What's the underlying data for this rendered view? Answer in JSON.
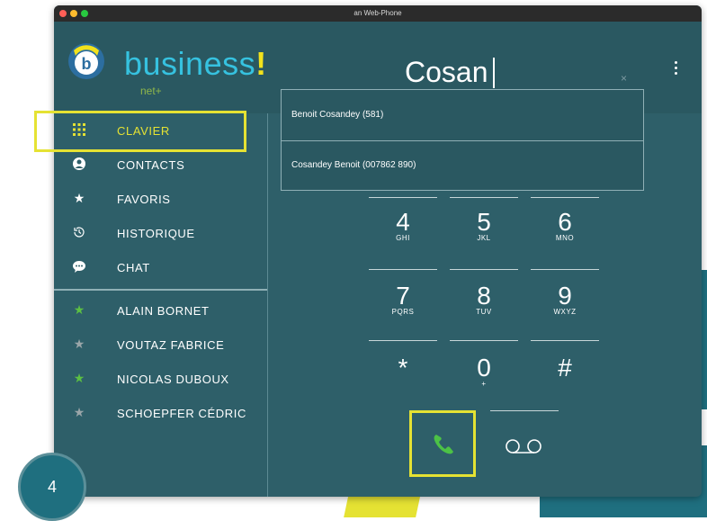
{
  "window": {
    "title": "an Web-Phone"
  },
  "logo": {
    "text": "business",
    "bang": "!",
    "sub": "net+"
  },
  "search": {
    "value": "Cosan",
    "clear_label": "×"
  },
  "sidebar": {
    "items": [
      {
        "label": "CLAVIER",
        "icon": "keypad-icon"
      },
      {
        "label": "CONTACTS",
        "icon": "contact-icon"
      },
      {
        "label": "FAVORIS",
        "icon": "star-icon"
      },
      {
        "label": "HISTORIQUE",
        "icon": "history-icon"
      },
      {
        "label": "CHAT",
        "icon": "chat-icon"
      }
    ],
    "favorites": [
      {
        "label": "ALAIN BORNET",
        "star": "#5cc043"
      },
      {
        "label": "VOUTAZ FABRICE",
        "star": "#9aa6a9"
      },
      {
        "label": "NICOLAS DUBOUX",
        "star": "#5cc043"
      },
      {
        "label": "SCHOEPFER CÉDRIC",
        "star": "#9aa6a9"
      }
    ]
  },
  "dropdown": {
    "items": [
      "Benoit Cosandey (581)",
      "Cosandey Benoit (007862   890)"
    ]
  },
  "keypad": {
    "keys": [
      {
        "digit": "4",
        "letters": "GHI"
      },
      {
        "digit": "5",
        "letters": "JKL"
      },
      {
        "digit": "6",
        "letters": "MNO"
      },
      {
        "digit": "7",
        "letters": "PQRS"
      },
      {
        "digit": "8",
        "letters": "TUV"
      },
      {
        "digit": "9",
        "letters": "WXYZ"
      },
      {
        "digit": "*",
        "letters": ""
      },
      {
        "digit": "0",
        "letters": "+"
      },
      {
        "digit": "#",
        "letters": ""
      }
    ]
  },
  "badge": {
    "number": "4"
  },
  "colors": {
    "accent": "#e5e233",
    "app_bg": "#2e5f69",
    "call_green": "#4cc246"
  }
}
